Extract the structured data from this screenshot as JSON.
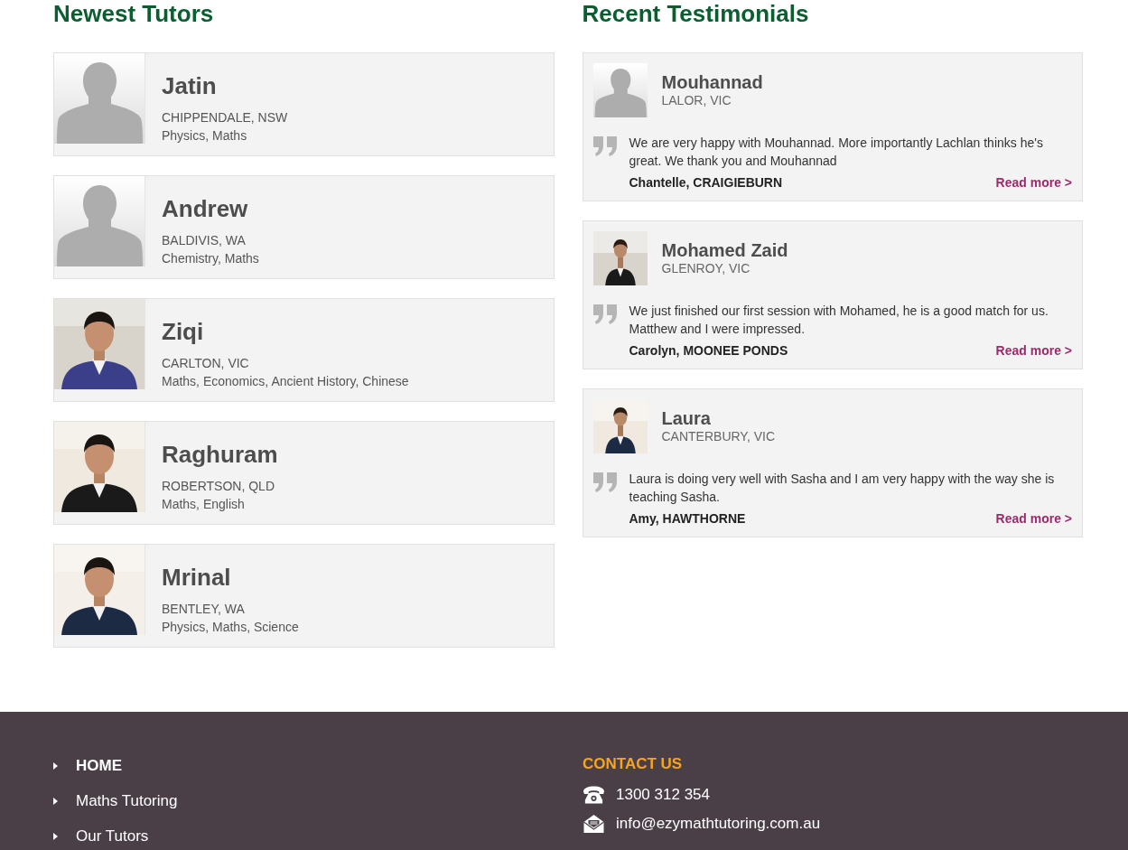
{
  "tutors": {
    "title": "Newest Tutors",
    "items": [
      {
        "name": "Jatin",
        "location": "CHIPPENDALE, NSW",
        "subjects": "Physics, Maths",
        "photo": {
          "kind": "placeholder"
        }
      },
      {
        "name": "Andrew",
        "location": "BALDIVIS, WA",
        "subjects": "Chemistry, Maths",
        "photo": {
          "kind": "placeholder"
        }
      },
      {
        "name": "Ziqi",
        "location": "CARLTON, VIC",
        "subjects": "Maths, Economics, Ancient History, Chinese"
      },
      {
        "name": "Raghuram",
        "location": "ROBERTSON, QLD",
        "subjects": "Maths, English"
      },
      {
        "name": "Mrinal",
        "location": "BENTLEY, WA",
        "subjects": "Physics, Maths, Science"
      }
    ]
  },
  "testimonials": {
    "title": "Recent Testimonials",
    "items": [
      {
        "name": "Mouhannad",
        "location": "LALOR, VIC",
        "quote": "We are very happy with Mouhannad. More importantly Lachlan thinks he's great. We thank you and Mouhannad",
        "author": "Chantelle, CRAIGIEBURN",
        "link": "Read more >",
        "photo": {
          "kind": "placeholder"
        }
      },
      {
        "name": "Mohamed Zaid",
        "location": "GLENROY, VIC",
        "quote": "We just finished our first session with Mohamed, he is a good match for us. Matthew and I were impressed.",
        "author": "Carolyn, MOONEE PONDS",
        "link": "Read more >"
      },
      {
        "name": "Laura",
        "location": "CANTERBURY, VIC",
        "quote": "Laura is doing very well with Sasha and I am very happy with the way she is teaching Sasha.",
        "author": "Amy, HAWTHORNE",
        "link": "Read more >"
      }
    ]
  },
  "footer": {
    "nav": [
      {
        "label": "HOME",
        "selected": true
      },
      {
        "label": "Maths Tutoring",
        "selected": false
      },
      {
        "label": "Our Tutors",
        "selected": false
      }
    ],
    "contact": {
      "title": "CONTACT US",
      "phone": "1300 312 354",
      "email": "info@ezymathtutoring.com.au"
    }
  }
}
